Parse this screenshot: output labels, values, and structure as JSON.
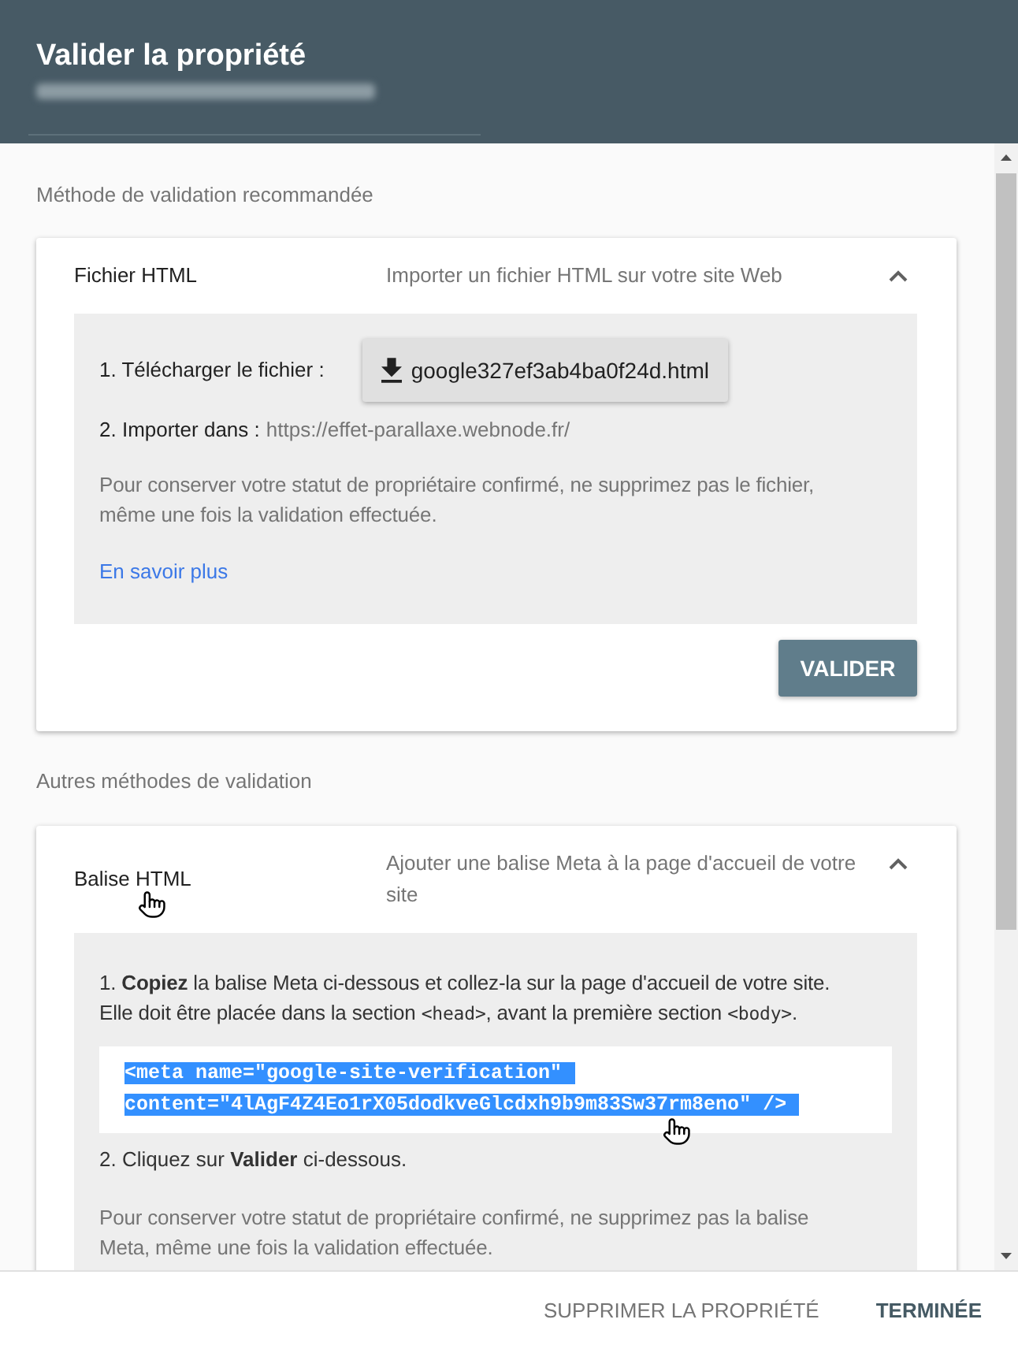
{
  "header": {
    "title": "Valider la propriété"
  },
  "sections": [
    {
      "heading": "Méthode de validation recommandée",
      "method": {
        "kind": "file",
        "name": "Fichier HTML",
        "description": "Importer un fichier HTML sur votre site Web",
        "expanded": true,
        "download_label": "1. Télécharger le fichier :",
        "file_name": "google327ef3ab4ba0f24d.html",
        "import_label": "2. Importer dans :",
        "import_url": "https://effet-parallaxe.webnode.fr/",
        "note": "Pour conserver votre statut de propriétaire confirmé, ne supprimez pas le fichier, même une fois la validation effectuée.",
        "link": "En savoir plus",
        "action": "VALIDER"
      }
    },
    {
      "heading": "Autres méthodes de validation",
      "method": {
        "kind": "meta",
        "name": "Balise HTML",
        "description": "Ajouter une balise Meta à la page d'accueil de votre site",
        "expanded": true,
        "instruction": [
          {
            "kind": "text",
            "text": "1. **Copiez** la balise Meta ci-dessous et collez-la sur la page d'accueil de votre site. Elle doit être placée dans la section "
          },
          {
            "kind": "code",
            "text": "<head>"
          },
          {
            "kind": "text",
            "text": ", avant la première section "
          },
          {
            "kind": "code",
            "text": "<body>"
          },
          {
            "kind": "text",
            "text": "."
          }
        ],
        "meta_tag": {
          "lines": [
            "<meta name=\"google-site-verification\"",
            "content=\"4lAgF4Z4Eo1rX05dodkveGlcdxh9b9m83Sw37rm8eno\" />"
          ],
          "selected": true
        },
        "step_2": "2. Cliquez sur **Valider** ci-dessous.",
        "note": "Pour conserver votre statut de propriétaire confirmé, ne supprimez pas la balise Meta, même une fois la validation effectuée."
      }
    }
  ],
  "footer": {
    "buttons": [
      {
        "kind": "secondary",
        "label": "SUPPRIMER LA PROPRIÉTÉ"
      },
      {
        "kind": "primary",
        "label": "TERMINÉE"
      }
    ]
  }
}
